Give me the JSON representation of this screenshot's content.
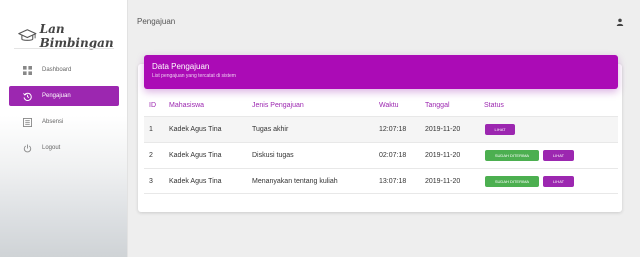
{
  "app": {
    "logo_text": "Lan Bimbingan"
  },
  "sidebar": {
    "items": [
      {
        "label": "Dashboard",
        "icon": "dashboard-icon"
      },
      {
        "label": "Pengajuan",
        "icon": "history-icon"
      },
      {
        "label": "Absensi",
        "icon": "list-icon"
      },
      {
        "label": "Logout",
        "icon": "power-icon"
      }
    ]
  },
  "topbar": {
    "title": "Pengajuan"
  },
  "card": {
    "title": "Data Pengajuan",
    "subtitle": "List pengajuan yang tercatat di sistem"
  },
  "table": {
    "headers": [
      "ID",
      "Mahasiswa",
      "Jenis Pengajuan",
      "Waktu",
      "Tanggal",
      "Status"
    ],
    "rows": [
      {
        "id": "1",
        "mahasiswa": "Kadek Agus Tina",
        "jenis": "Tugas akhir",
        "waktu": "12:07:18",
        "tanggal": "2019-11-20",
        "accepted_label": "",
        "view_label": "LIHAT"
      },
      {
        "id": "2",
        "mahasiswa": "Kadek Agus Tina",
        "jenis": "Diskusi tugas",
        "waktu": "02:07:18",
        "tanggal": "2019-11-20",
        "accepted_label": "SUDAH DITERIMA",
        "view_label": "LIHAT"
      },
      {
        "id": "3",
        "mahasiswa": "Kadek Agus Tina",
        "jenis": "Menanyakan tentang kuliah",
        "waktu": "13:07:18",
        "tanggal": "2019-11-20",
        "accepted_label": "SUDAH DITERIMA",
        "view_label": "LIHAT"
      }
    ]
  },
  "colors": {
    "accent": "#9c27b0",
    "success": "#4caf50"
  }
}
